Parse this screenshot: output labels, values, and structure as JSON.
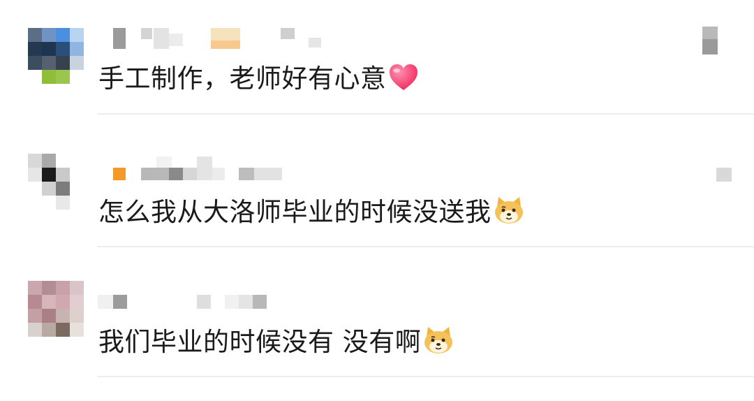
{
  "comments": [
    {
      "text": "手工制作，老师好有心意",
      "emoji": "heart-icon",
      "username": "",
      "avatar_colors": [
        "#5b6e86",
        "#6f93c2",
        "#4b8fe0",
        "#b7d4f2",
        "#24384f",
        "#1d3550",
        "#2a4f7a",
        "#8fb6e0",
        "#3b4d5e",
        "#556170",
        "#36424f",
        "#c8d3dd",
        "#ffffff",
        "#8fbf3a",
        "#9bc64e",
        "#ffffff"
      ]
    },
    {
      "text": "怎么我从大洛师毕业的时候没送我",
      "emoji": "doge-icon",
      "username": "",
      "avatar_colors": [
        "#d8d8d8",
        "#a9a9a9",
        "#ffffff",
        "#ffffff",
        "#e6e6e6",
        "#1b1b1b",
        "#c9c9c9",
        "#ffffff",
        "#ffffff",
        "#d0d0d0",
        "#7c7c7c",
        "#ffffff",
        "#ffffff",
        "#ffffff",
        "#e8e8e8",
        "#ffffff"
      ]
    },
    {
      "text": "我们毕业的时候没有 没有啊",
      "emoji": "doge-icon",
      "username": "",
      "avatar_colors": [
        "#c9a7ad",
        "#b38d94",
        "#c9a1a8",
        "#d9c4c7",
        "#b78991",
        "#d7b5ba",
        "#cfa9ae",
        "#e3cdd0",
        "#c49fa4",
        "#aa8087",
        "#c7b3b0",
        "#ddd0cd",
        "#d8d2cf",
        "#b9a9a3",
        "#7a6a5f",
        "#e7e1de"
      ]
    }
  ]
}
